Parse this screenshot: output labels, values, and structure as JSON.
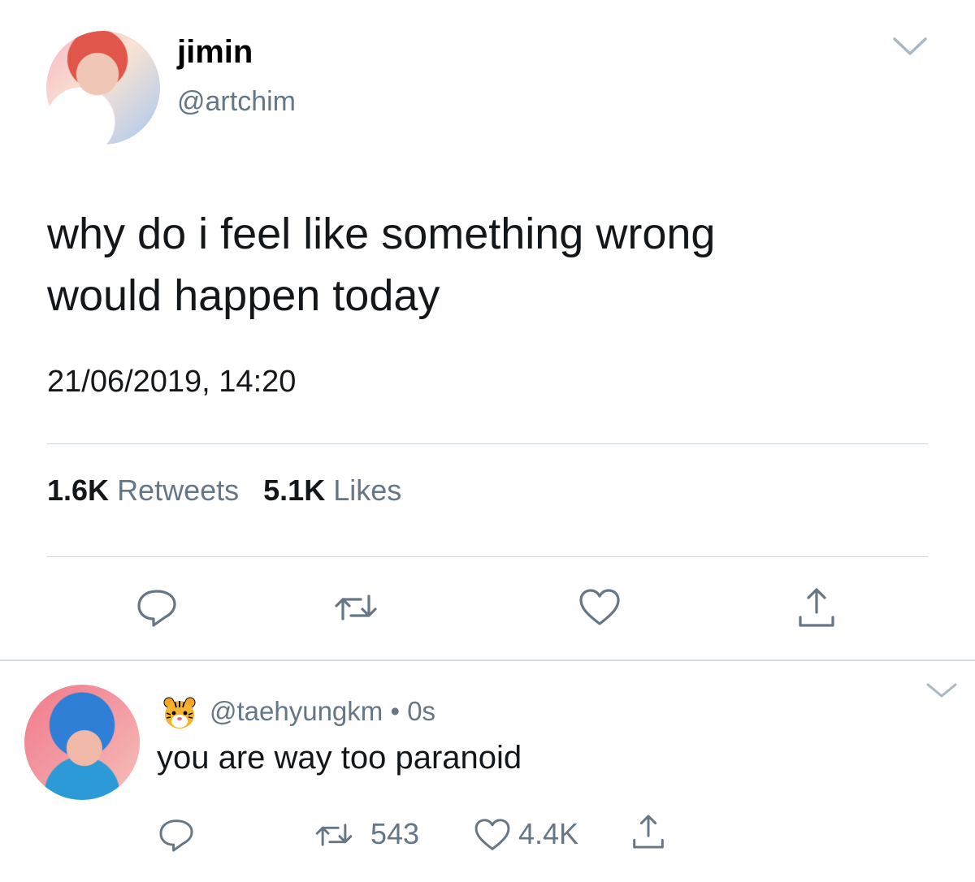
{
  "tweet": {
    "display_name": "jimin",
    "handle": "@artchim",
    "text_line_1": "why do i feel like something wrong",
    "text_line_2": "would happen today",
    "timestamp": "21/06/2019, 14:20",
    "retweets_count": "1.6K",
    "retweets_label": "Retweets",
    "likes_count": "5.1K",
    "likes_label": "Likes"
  },
  "reply": {
    "emoji": "tiger-face-emoji",
    "handle": "@taehyungkm",
    "separator": "•",
    "time": "0s",
    "text": "you are way too paranoid",
    "retweets_count": "543",
    "likes_count": "4.4K"
  },
  "icons": {
    "reply": "reply-icon",
    "retweet": "retweet-icon",
    "like": "heart-icon",
    "share": "share-icon",
    "menu": "chevron-down-icon"
  },
  "colors": {
    "text_primary": "#14171a",
    "text_secondary": "#657786",
    "divider": "#ccd6dd"
  }
}
